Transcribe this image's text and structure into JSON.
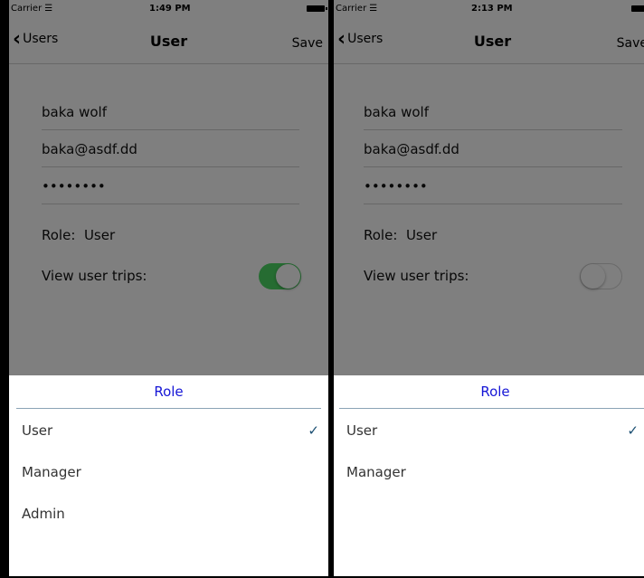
{
  "left": {
    "status": {
      "carrier": "Carrier",
      "time": "1:49 PM"
    },
    "nav": {
      "back": "Users",
      "title": "User",
      "save": "Save"
    },
    "form": {
      "name": "baka wolf",
      "email": "baka@asdf.dd",
      "password": "••••••••",
      "role_label": "Role:",
      "role_value": "User",
      "trips_label": "View user trips:",
      "trips_enabled": true
    },
    "sheet": {
      "title": "Role",
      "options": [
        "User",
        "Manager",
        "Admin"
      ],
      "selected": "User",
      "check": "✓"
    }
  },
  "right": {
    "status": {
      "carrier": "Carrier",
      "time": "2:13 PM"
    },
    "nav": {
      "back": "Users",
      "title": "User",
      "save": "Save"
    },
    "form": {
      "name": "baka wolf",
      "email": "baka@asdf.dd",
      "password": "••••••••",
      "role_label": "Role:",
      "role_value": "User",
      "trips_label": "View user trips:",
      "trips_enabled": false
    },
    "sheet": {
      "title": "Role",
      "options": [
        "User",
        "Manager"
      ],
      "selected": "User",
      "check": "✓"
    }
  },
  "colors": {
    "accent": "#1616d6",
    "toggle_on": "#4cd964",
    "check": "#1b4f72",
    "overlay": "#00000080"
  },
  "icons": {
    "wifi": "wifi-icon",
    "battery": "battery-icon",
    "back": "chevron-left-icon",
    "check": "checkmark-icon"
  }
}
